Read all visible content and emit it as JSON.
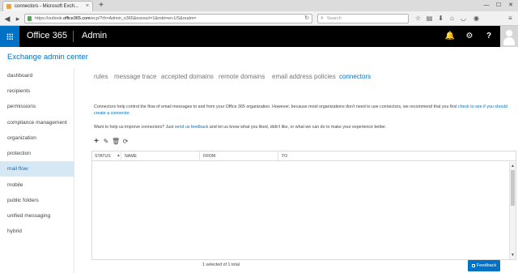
{
  "browser": {
    "tab_title": "connectors - Microsoft Exch...",
    "tab_close_glyph": "×",
    "new_tab_glyph": "+",
    "window_buttons": [
      "—",
      "☐",
      "✕"
    ],
    "url_prefix": "https://outlook.",
    "url_domain": "office365.com",
    "url_rest": "/ecp/?rfr=Admin_o365&exsvurl=1&mkt=en-US&realm=",
    "search_placeholder": "Search",
    "icons": [
      "back-icon",
      "forward-icon",
      "lock-icon",
      "reload-icon",
      "search-icon",
      "bookmark-star-icon",
      "reading-list-icon",
      "download-icon",
      "home-icon",
      "pocket-icon",
      "menu-icon"
    ]
  },
  "o365_header": {
    "brand": "Office 365",
    "section": "Admin",
    "icons": [
      "app-launcher-icon",
      "notifications-bell-icon",
      "settings-gear-icon",
      "help-icon",
      "user-avatar-icon"
    ],
    "accent": "#0072c6"
  },
  "eac": {
    "title": "Exchange admin center",
    "sidebar": [
      {
        "label": "dashboard"
      },
      {
        "label": "recipients"
      },
      {
        "label": "permissions"
      },
      {
        "label": "compliance management"
      },
      {
        "label": "organization"
      },
      {
        "label": "protection"
      },
      {
        "label": "mail flow",
        "active": true
      },
      {
        "label": "mobile"
      },
      {
        "label": "public folders"
      },
      {
        "label": "unified messaging"
      },
      {
        "label": "hybrid"
      }
    ],
    "tabs": [
      {
        "label": "rules"
      },
      {
        "label": "message trace"
      },
      {
        "label": "accepted domains"
      },
      {
        "label": "remote domains"
      },
      {
        "label": "email address policies"
      },
      {
        "label": "connectors",
        "active": true
      }
    ],
    "description": {
      "text_before": "Connectors help control the flow of email messages to and from your Office 365 organization. However, because most organizations don't need to use connectors, we recommend that you first ",
      "link1": "check to see if you should create a connector",
      "text_after": "."
    },
    "improve": {
      "text_before": "Want to help us improve connectors? Just ",
      "link": "send us feedback",
      "text_after": " and let us know what you liked, didn't like, or what we can do to make your experience better."
    },
    "toolbar": [
      "add-icon",
      "edit-icon",
      "delete-icon",
      "refresh-icon"
    ],
    "grid": {
      "columns": [
        "STATUS",
        "NAME",
        "FROM",
        "TO"
      ],
      "sort_indicator": "▲",
      "rows": []
    },
    "status_line": "1 selected of 1 total",
    "feedback_button": "Feedback"
  }
}
